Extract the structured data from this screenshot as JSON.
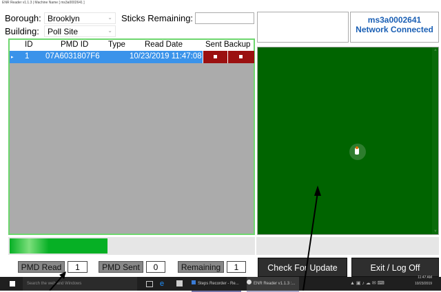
{
  "window": {
    "title": "ENR Reader v1.1.3 | Machine Name [ ms3a0002641 ]"
  },
  "form": {
    "borough_label": "Borough:",
    "borough_value": "Brooklyn",
    "building_label": "Building:",
    "building_value": "Poll Site",
    "sticks_label": "Sticks Remaining:",
    "sticks_value": ""
  },
  "status": {
    "machine": "ms3a0002641",
    "network": "Network Connected"
  },
  "grid": {
    "columns": [
      "ID",
      "PMD ID",
      "Type",
      "Read Date",
      "Sent",
      "Backup"
    ],
    "rows": [
      {
        "id": "1",
        "pmd_id": "07A6031807F6",
        "type": "",
        "read_date": "10/23/2019 11:47:08",
        "sent": true,
        "backup": true
      }
    ]
  },
  "progress": {
    "fraction": 0.4
  },
  "counters": {
    "pmd_read_label": "PMD Read",
    "pmd_read_value": "1",
    "pmd_sent_label": "PMD Sent",
    "pmd_sent_value": "0",
    "remaining_label": "Remaining",
    "remaining_value": "1"
  },
  "buttons": {
    "check_update": "Check For Update",
    "exit": "Exit / Log Off"
  },
  "taskbar": {
    "search_placeholder": "Search the web and Windows",
    "steps_recorder": "Steps Recorder - Re...",
    "enr_reader": "ENR Reader v1.1.3 :...",
    "time": "11:47 AM",
    "date": "10/23/2019"
  },
  "colors": {
    "accent_blue": "#1a5fb4",
    "row_selected": "#3a93ea",
    "sent_cell": "#9b1010",
    "panel_green": "#006400",
    "grid_border": "#6dd66d"
  }
}
